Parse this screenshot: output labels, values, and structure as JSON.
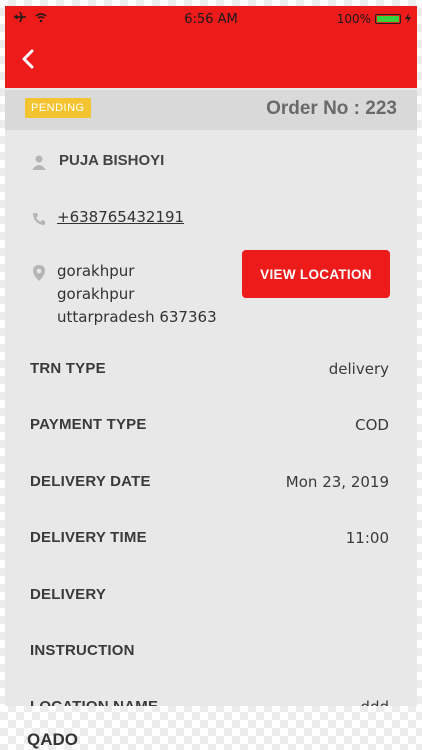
{
  "status_bar": {
    "time": "6:56 AM",
    "battery": "100%",
    "battery_level": 1.0,
    "icons": [
      "airplane-icon",
      "wifi-icon",
      "battery-icon",
      "charging-icon"
    ]
  },
  "colors": {
    "primary": "#ee1b1b",
    "badge": "#f4c430",
    "background": "#e8e8e8"
  },
  "order": {
    "status": "PENDING",
    "number_label": "Order No : 223"
  },
  "customer": {
    "name": "PUJA BISHOYI",
    "phone": "+638765432191",
    "address_lines": [
      "gorakhpur",
      "gorakhpur",
      "uttarpradesh 637363"
    ]
  },
  "actions": {
    "view_location": "VIEW LOCATION"
  },
  "details": [
    {
      "label": "TRN TYPE",
      "value": "delivery"
    },
    {
      "label": "PAYMENT TYPE",
      "value": "COD"
    },
    {
      "label": "DELIVERY DATE",
      "value": "Mon 23, 2019"
    },
    {
      "label": "DELIVERY TIME",
      "value": "11:00"
    },
    {
      "label": "DELIVERY",
      "value": ""
    },
    {
      "label": "INSTRUCTION",
      "value": ""
    },
    {
      "label": "LOCATION NAME",
      "value": "ddd"
    }
  ],
  "cutoff_text": "QADO"
}
